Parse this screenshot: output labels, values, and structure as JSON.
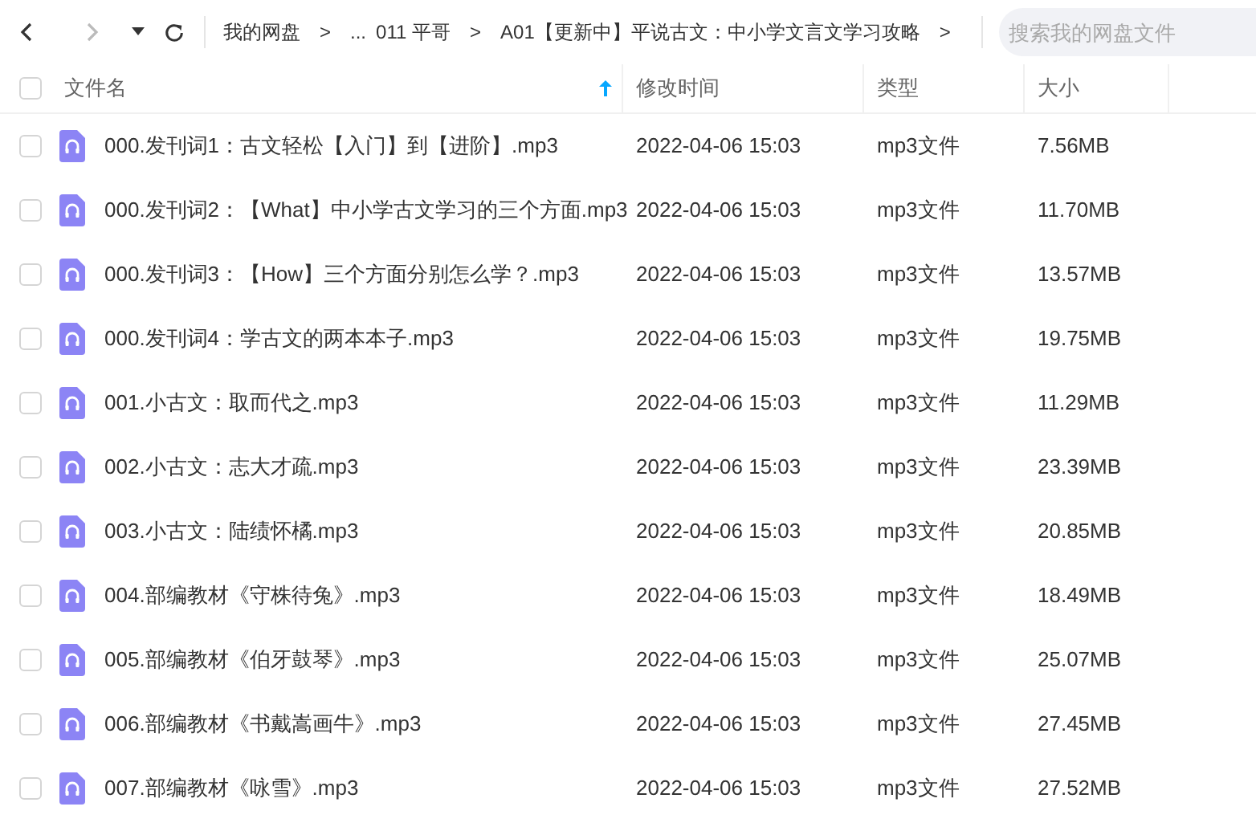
{
  "toolbar": {
    "breadcrumb": [
      {
        "kind": "crumb",
        "text": "我的网盘"
      },
      {
        "kind": "sep",
        "text": ">"
      },
      {
        "kind": "crumb",
        "text": "..."
      },
      {
        "kind": "crumb",
        "text": "011 平哥"
      },
      {
        "kind": "sep",
        "text": ">"
      },
      {
        "kind": "crumb",
        "text": "A01【更新中】平说古文：中小学文言文学习攻略"
      },
      {
        "kind": "sep",
        "text": ">"
      }
    ],
    "search": {
      "placeholder": "搜索我的网盘文件"
    }
  },
  "table": {
    "select_all": {
      "checked": false
    },
    "columns": [
      {
        "label": "文件名",
        "sorted": true
      },
      {
        "label": "修改时间",
        "sorted": false
      },
      {
        "label": "类型",
        "sorted": false
      },
      {
        "label": "大小",
        "sorted": false
      }
    ],
    "rows": [
      {
        "checked": false,
        "name": "000.发刊词1：古文轻松【入门】到【进阶】.mp3",
        "modified": "2022-04-06 15:03",
        "type": "mp3文件",
        "size": "7.56MB"
      },
      {
        "checked": false,
        "name": "000.发刊词2：【What】中小学古文学习的三个方面.mp3",
        "modified": "2022-04-06 15:03",
        "type": "mp3文件",
        "size": "11.70MB"
      },
      {
        "checked": false,
        "name": "000.发刊词3：【How】三个方面分别怎么学？.mp3",
        "modified": "2022-04-06 15:03",
        "type": "mp3文件",
        "size": "13.57MB"
      },
      {
        "checked": false,
        "name": "000.发刊词4：学古文的两本本子.mp3",
        "modified": "2022-04-06 15:03",
        "type": "mp3文件",
        "size": "19.75MB"
      },
      {
        "checked": false,
        "name": "001.小古文：取而代之.mp3",
        "modified": "2022-04-06 15:03",
        "type": "mp3文件",
        "size": "11.29MB"
      },
      {
        "checked": false,
        "name": "002.小古文：志大才疏.mp3",
        "modified": "2022-04-06 15:03",
        "type": "mp3文件",
        "size": "23.39MB"
      },
      {
        "checked": false,
        "name": "003.小古文：陆绩怀橘.mp3",
        "modified": "2022-04-06 15:03",
        "type": "mp3文件",
        "size": "20.85MB"
      },
      {
        "checked": false,
        "name": "004.部编教材《守株待兔》.mp3",
        "modified": "2022-04-06 15:03",
        "type": "mp3文件",
        "size": "18.49MB"
      },
      {
        "checked": false,
        "name": "005.部编教材《伯牙鼓琴》.mp3",
        "modified": "2022-04-06 15:03",
        "type": "mp3文件",
        "size": "25.07MB"
      },
      {
        "checked": false,
        "name": "006.部编教材《书戴嵩画牛》.mp3",
        "modified": "2022-04-06 15:03",
        "type": "mp3文件",
        "size": "27.45MB"
      },
      {
        "checked": false,
        "name": "007.部编教材《咏雪》.mp3",
        "modified": "2022-04-06 15:03",
        "type": "mp3文件",
        "size": "27.52MB"
      }
    ]
  }
}
